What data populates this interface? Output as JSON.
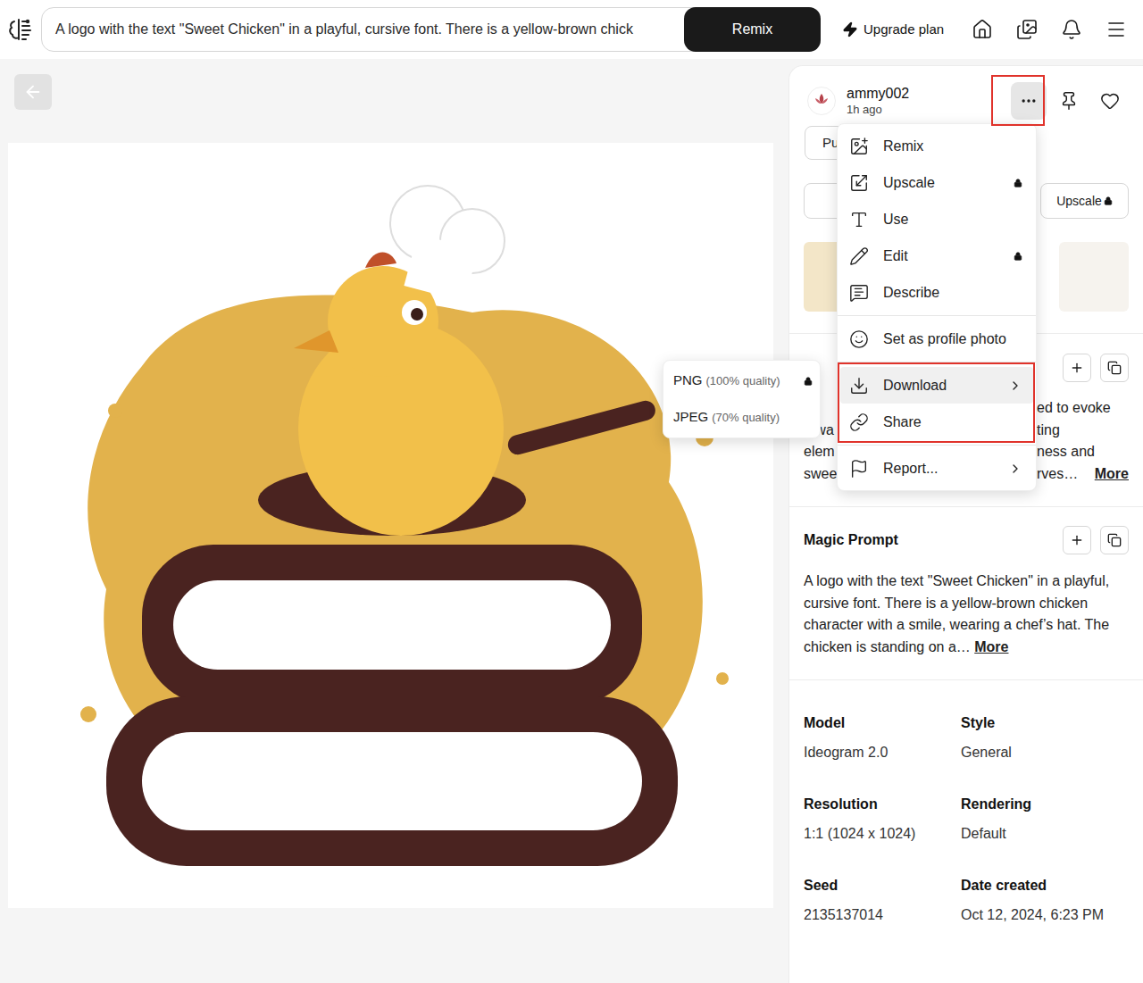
{
  "topbar": {
    "prompt": "A logo with the text \"Sweet Chicken\" in a playful, cursive font. There is a yellow-brown chick",
    "remix": "Remix",
    "upgrade": "Upgrade plan"
  },
  "author": {
    "name": "ammy002",
    "time": "1h ago",
    "more_outlined": true
  },
  "actions": {
    "partial": "Pu",
    "upscale": "Upscale",
    "upscale_locked": true
  },
  "description": {
    "lines": [
      {
        "left": "",
        "right": "ed to evoke"
      },
      {
        "left": "a wa",
        "right": "ting"
      },
      {
        "left": "elem",
        "right": "ness and"
      },
      {
        "left": "swee",
        "right": "rves…"
      }
    ],
    "more": "More"
  },
  "magic_prompt": {
    "title": "Magic Prompt",
    "text": "A logo with the text \"Sweet Chicken\" in a playful, cursive font. There is a yellow-brown chicken character with a smile, wearing a chef’s hat. The chicken is standing on a…",
    "more": "More"
  },
  "details": [
    {
      "label": "Model",
      "value": "Ideogram 2.0"
    },
    {
      "label": "Style",
      "value": "General"
    },
    {
      "label": "Resolution",
      "value": "1:1 (1024 x 1024)"
    },
    {
      "label": "Rendering",
      "value": "Default"
    },
    {
      "label": "Seed",
      "value": "2135137014"
    },
    {
      "label": "Date created",
      "value": "Oct 12, 2024, 6:23 PM"
    }
  ],
  "menu": {
    "items": [
      {
        "label": "Remix",
        "group": 1,
        "locked": false,
        "submenu": false,
        "highlighted": false,
        "outlined": false
      },
      {
        "label": "Upscale",
        "group": 1,
        "locked": true,
        "submenu": false,
        "highlighted": false,
        "outlined": false
      },
      {
        "label": "Use",
        "group": 1,
        "locked": false,
        "submenu": false,
        "highlighted": false,
        "outlined": false
      },
      {
        "label": "Edit",
        "group": 1,
        "locked": true,
        "submenu": false,
        "highlighted": false,
        "outlined": false
      },
      {
        "label": "Describe",
        "group": 1,
        "locked": false,
        "submenu": false,
        "highlighted": false,
        "outlined": false
      },
      {
        "label": "Set as profile photo",
        "group": 2,
        "locked": false,
        "submenu": false,
        "highlighted": false,
        "outlined": false
      },
      {
        "label": "Download",
        "group": 3,
        "locked": false,
        "submenu": true,
        "highlighted": true,
        "outlined": true
      },
      {
        "label": "Share",
        "group": 3,
        "locked": false,
        "submenu": false,
        "highlighted": false,
        "outlined": true
      },
      {
        "label": "Report...",
        "group": 4,
        "locked": false,
        "submenu": true,
        "highlighted": false,
        "outlined": false
      }
    ]
  },
  "submenu": {
    "items": [
      {
        "label": "PNG",
        "detail": "(100% quality)",
        "locked": true
      },
      {
        "label": "JPEG",
        "detail": "(70% quality)",
        "locked": false
      }
    ]
  }
}
